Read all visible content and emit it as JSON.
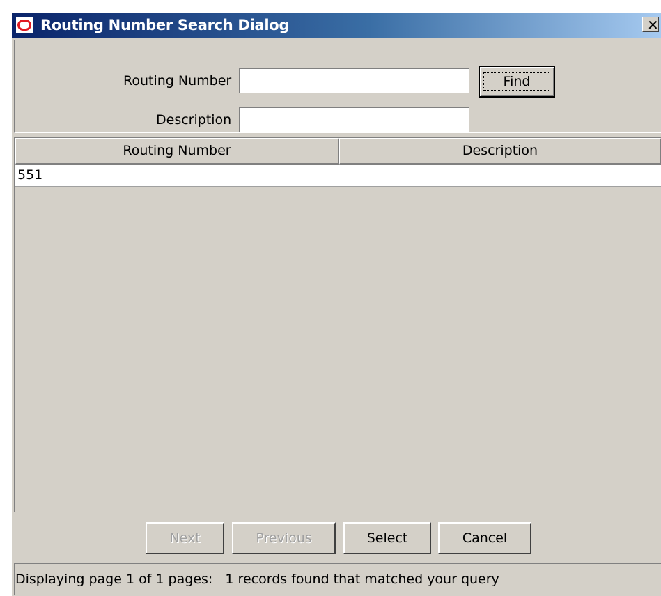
{
  "window": {
    "title": "Routing Number Search Dialog",
    "close_label": "✕"
  },
  "search": {
    "routing_number_label": "Routing Number",
    "routing_number_value": "",
    "description_label": "Description",
    "description_value": "",
    "find_label": "Find"
  },
  "table": {
    "columns": [
      "Routing Number",
      "Description"
    ],
    "rows": [
      [
        "551",
        ""
      ]
    ]
  },
  "buttons": {
    "next_label": "Next",
    "previous_label": "Previous",
    "select_label": "Select",
    "cancel_label": "Cancel"
  },
  "status": {
    "text": "Displaying page 1 of 1 pages:   1 records found that matched your query"
  },
  "icons": {
    "app_icon": "oracle-logo-icon",
    "close_icon": "close-icon"
  }
}
